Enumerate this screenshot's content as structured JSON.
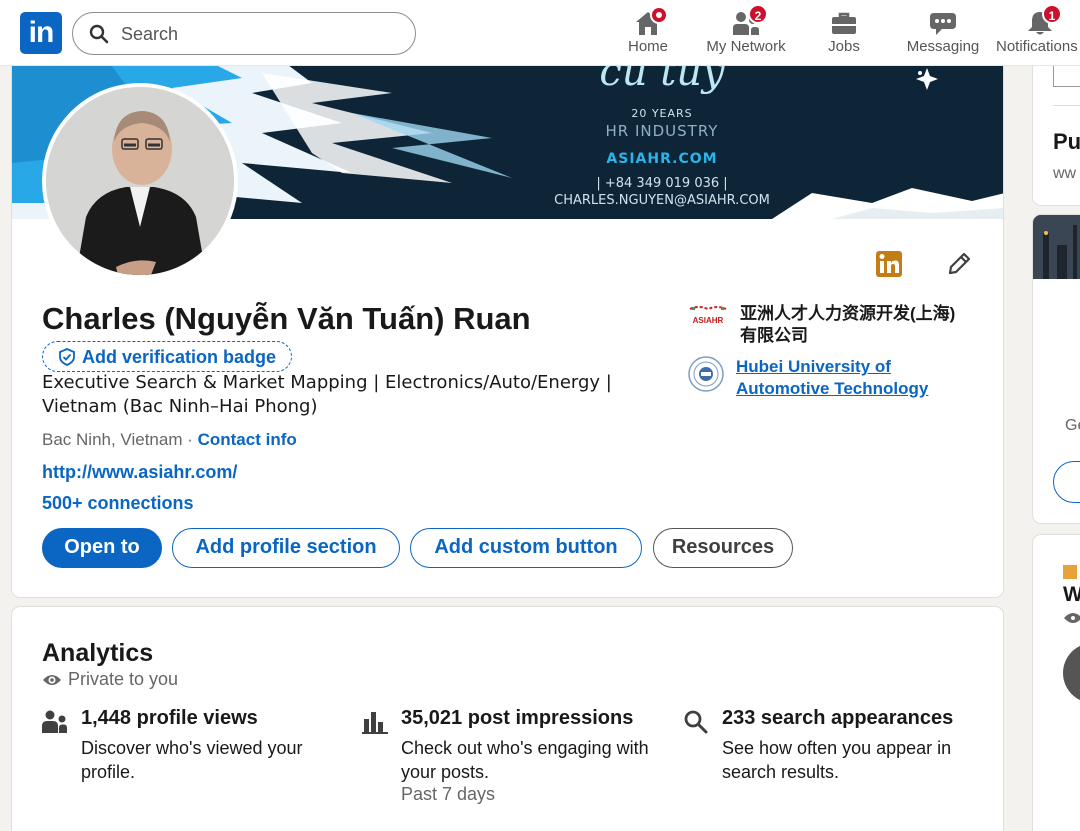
{
  "nav": {
    "search_placeholder": "Search",
    "items": [
      {
        "label": "Home",
        "badge": ""
      },
      {
        "label": "My Network",
        "badge": "2"
      },
      {
        "label": "Jobs",
        "badge": ""
      },
      {
        "label": "Messaging",
        "badge": ""
      },
      {
        "label": "Notifications",
        "badge": "1"
      }
    ]
  },
  "banner": {
    "script_text": "cu tuy",
    "years": "20 YEARS",
    "industry": "HR INDUSTRY",
    "site": "ASIAHR.COM",
    "phone": "| +84 349 019 036 |",
    "email": "CHARLES.NGUYEN@ASIAHR.COM"
  },
  "profile": {
    "name": "Charles (Nguyễn Văn Tuấn) Ruan",
    "verify_label": "Add verification badge",
    "headline": "Executive Search & Market Mapping | Electronics/Auto/Energy | Vietnam (Bac Ninh–Hai Phong)",
    "location": "Bac Ninh, Vietnam",
    "location_sep": " · ",
    "contact_info": "Contact info",
    "website": "http://www.asiahr.com/",
    "connections": "500+ connections",
    "buttons": {
      "open_to": "Open to",
      "add_section": "Add profile section",
      "add_custom": "Add custom button",
      "resources": "Resources"
    },
    "company": {
      "logo_text": "ASIAHR",
      "name": "亚洲人才人力资源开发(上海)有限公司"
    },
    "education": {
      "name": "Hubei University of Automotive Technology"
    }
  },
  "analytics": {
    "title": "Analytics",
    "subtitle": "Private to you",
    "stats": [
      {
        "title": "1,448 profile views",
        "desc": "Discover who's viewed your profile.",
        "note": ""
      },
      {
        "title": "35,021 post impressions",
        "desc": "Check out who's engaging with your posts.",
        "note": "Past 7 days"
      },
      {
        "title": "233 search appearances",
        "desc": "See how often you appear in search results.",
        "note": ""
      }
    ]
  },
  "right_rail": {
    "card1_title": "Pu",
    "card1_sub": "ww",
    "card2_text": "Ge",
    "card3_title": "W"
  },
  "colors": {
    "brand": "#0a66c2",
    "notification": "#cb112d",
    "banner": "#0d2536",
    "accent_blue": "#29a8e8"
  }
}
